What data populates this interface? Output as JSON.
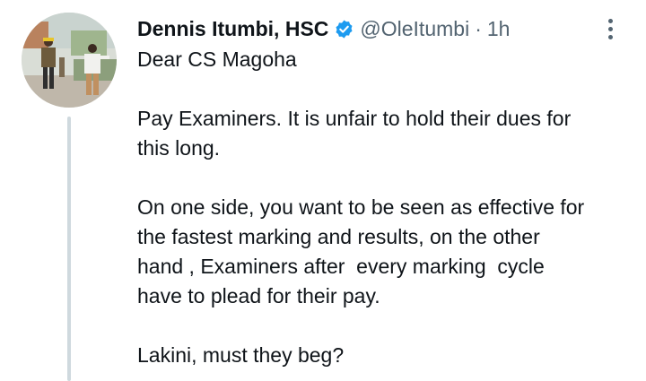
{
  "author": {
    "name": "Dennis Itumbi, HSC",
    "handle": "@OleItumbi",
    "separator": "·",
    "time": "1h"
  },
  "icons": {
    "verified": "verified-badge-icon",
    "more": "more-options-icon"
  },
  "colors": {
    "verified": "#1d9bf0",
    "secondary_text": "#536471",
    "thread_line": "#cfd9de"
  },
  "tweet": {
    "greeting": "Dear CS Magoha",
    "p1_l1": "Pay Examiners. It is unfair to hold their dues for",
    "p1_l2": "this long.",
    "p2_l1": "On one side, you want to be seen as effective for",
    "p2_l2": "the fastest marking and results, on the other",
    "p2_l3": "hand , Examiners after  every marking  cycle",
    "p2_l4": "have to plead for their pay.",
    "p3": "Lakini, must they beg?"
  }
}
